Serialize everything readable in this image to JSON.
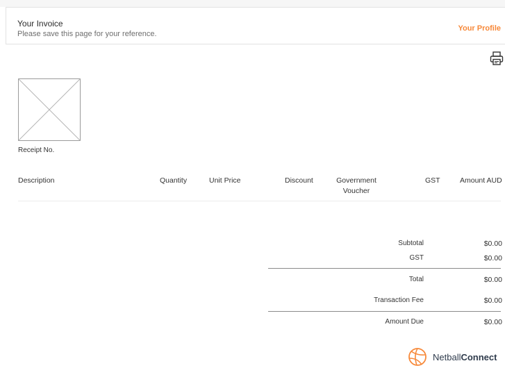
{
  "header": {
    "title": "Your Invoice",
    "subtitle": "Please save this page for your reference.",
    "profile_link": "Your Profile"
  },
  "icons": {
    "print": "printer-icon",
    "logo_placeholder": "image-placeholder-icon",
    "brand_mark": "netball-icon"
  },
  "receipt": {
    "label": "Receipt No."
  },
  "table": {
    "headers": {
      "description": "Description",
      "quantity": "Quantity",
      "unit_price": "Unit Price",
      "discount": "Discount",
      "government_voucher_line1": "Government",
      "government_voucher_line2": "Voucher",
      "gst": "GST",
      "amount": "Amount AUD"
    },
    "rows": []
  },
  "summary": {
    "subtotal_label": "Subtotal",
    "subtotal_value": "$0.00",
    "gst_label": "GST",
    "gst_value": "$0.00",
    "total_label": "Total",
    "total_value": "$0.00",
    "fee_label": "Transaction Fee",
    "fee_value": "$0.00",
    "due_label": "Amount Due",
    "due_value": "$0.00"
  },
  "brand": {
    "name_part1": "Netball",
    "name_part2": "Connect"
  },
  "colors": {
    "accent": "#f7893a",
    "brand_text": "#2f3b4c"
  }
}
